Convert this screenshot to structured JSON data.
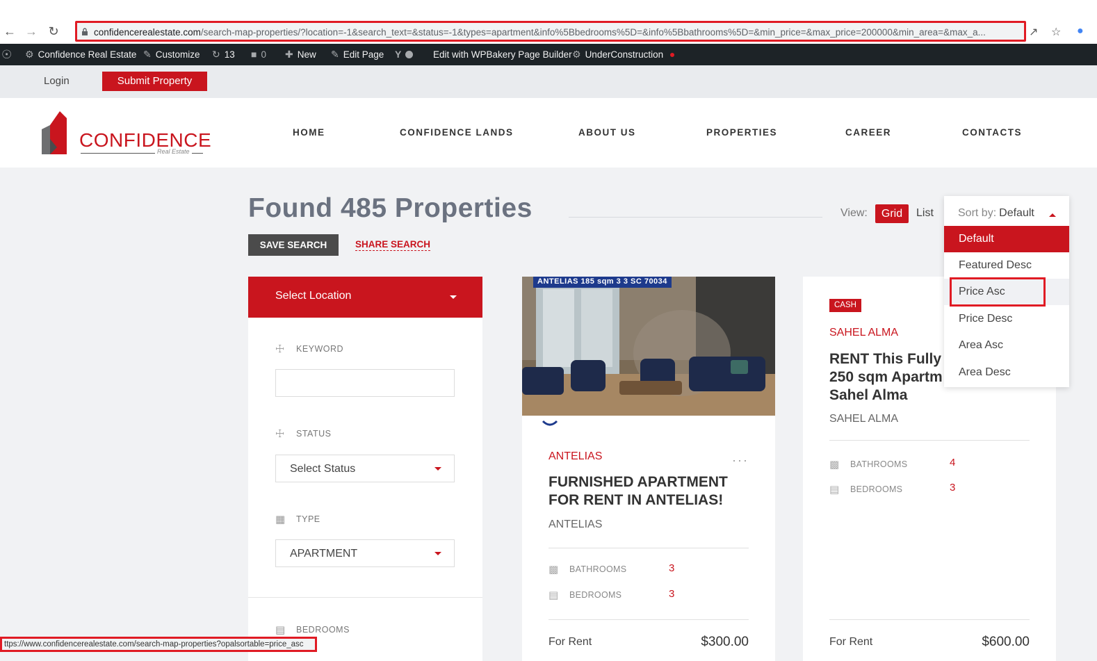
{
  "browser": {
    "url_domain": "confidencerealestate.com",
    "url_rest": "/search-map-properties/?location=-1&search_text=&status=-1&types=apartment&info%5Bbedrooms%5D=&info%5Bbathrooms%5D=&min_price=&max_price=200000&min_area=&max_a..."
  },
  "admin_bar": {
    "site_name": "Confidence Real Estate",
    "customize": "Customize",
    "updates": "13",
    "comments": "0",
    "new": "New",
    "edit_page": "Edit Page",
    "wpbakery": "Edit with WPBakery Page Builder",
    "under_construction": "UnderConstruction"
  },
  "top_strip": {
    "login": "Login",
    "submit_property": "Submit Property"
  },
  "logo": {
    "name": "CONFIDENCE",
    "tagline": "Real Estate"
  },
  "menu": [
    "HOME",
    "CONFIDENCE LANDS",
    "ABOUT US",
    "PROPERTIES",
    "CAREER",
    "CONTACTS"
  ],
  "results": {
    "title": "Found 485 Properties",
    "view_label": "View:",
    "grid": "Grid",
    "list": "List",
    "save_search": "SAVE SEARCH",
    "share_search": "SHARE SEARCH"
  },
  "sort": {
    "label": "Sort by:",
    "value": "Default",
    "options": [
      "Default",
      "Featured Desc",
      "Price Asc",
      "Price Desc",
      "Area Asc",
      "Area Desc"
    ]
  },
  "sidebar": {
    "select_location": "Select Location",
    "keyword_label": "KEYWORD",
    "keyword_value": "",
    "status_label": "STATUS",
    "status_value": "Select Status",
    "type_label": "TYPE",
    "type_value": "APARTMENT",
    "bedrooms_label": "BEDROOMS"
  },
  "cards": [
    {
      "img_strip": "ANTELIAS   185 sqm   3   3   SC 70034",
      "location": "ANTELIAS",
      "title": "FURNISHED APARTMENT FOR RENT IN ANTELIAS!",
      "sub": "ANTELIAS",
      "bathrooms_label": "BATHROOMS",
      "bathrooms": "3",
      "bedrooms_label": "BEDROOMS",
      "bedrooms": "3",
      "for_label": "For Rent",
      "price": "$300.00"
    },
    {
      "badge": "CASH",
      "location": "SAHEL ALMA",
      "title": "RENT This Fully 250 sqm Apartm Sahel Alma",
      "sub": "SAHEL ALMA",
      "bathrooms_label": "BATHROOMS",
      "bathrooms": "4",
      "bedrooms_label": "BEDROOMS",
      "bedrooms": "3",
      "for_label": "For Rent",
      "price": "$600.00"
    }
  ],
  "status_bar": {
    "text": "ttps://www.confidencerealestate.com/search-map-properties?opalsortable=price_asc"
  },
  "colors": {
    "brand_red": "#c9151e",
    "highlight_red": "#e01b24",
    "admin_bar": "#1d2327"
  }
}
